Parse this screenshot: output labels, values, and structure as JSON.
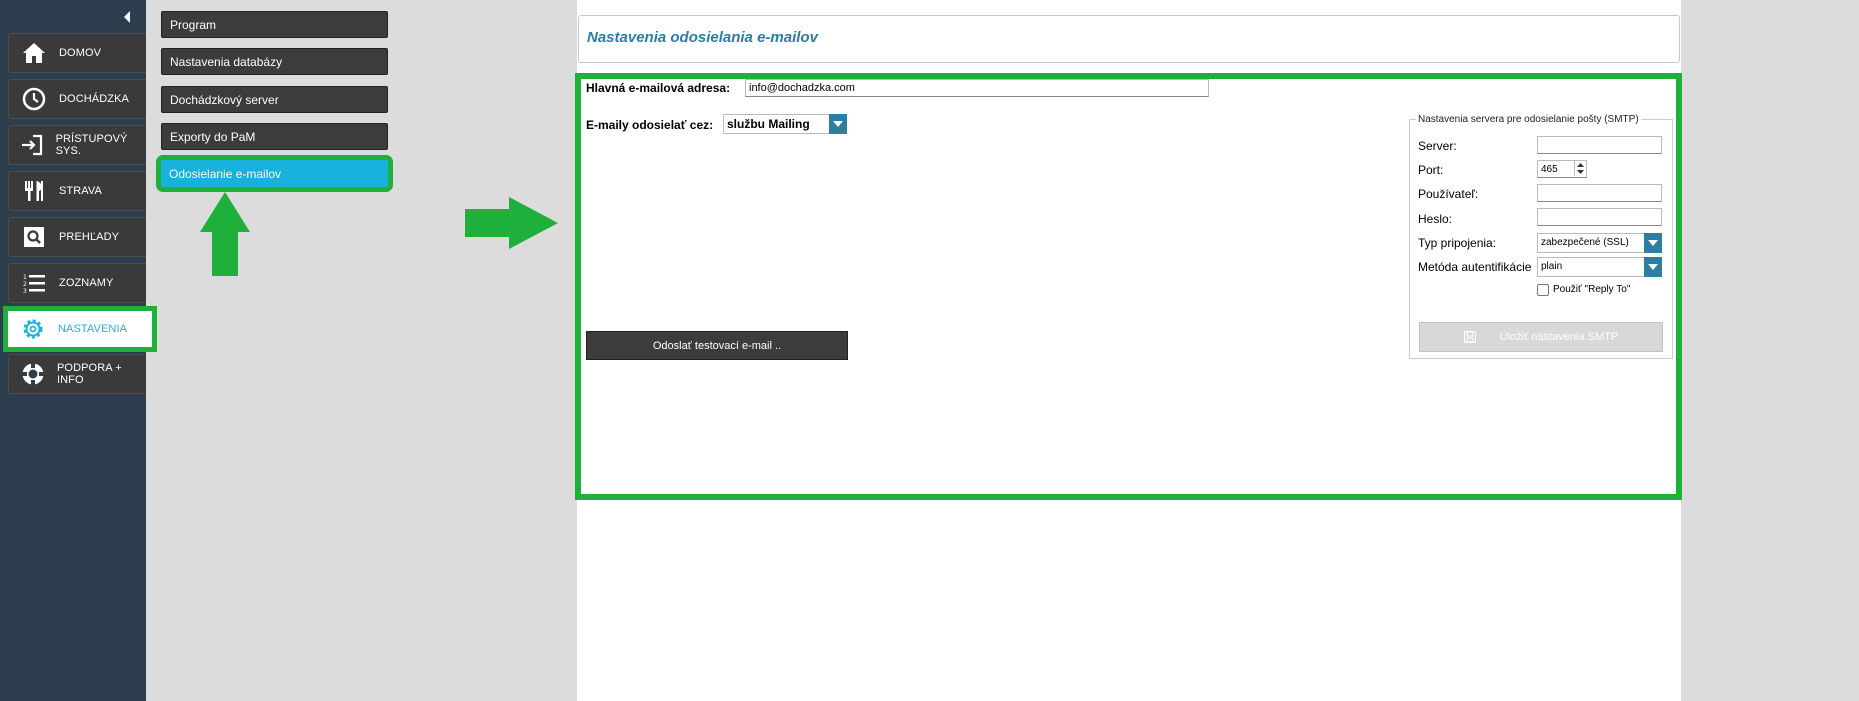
{
  "sidebar": {
    "items": [
      {
        "label": "DOMOV",
        "icon": "home-icon"
      },
      {
        "label": "DOCHÁDZKA",
        "icon": "clock-icon"
      },
      {
        "label": "PRÍSTUPOVÝ SYS.",
        "icon": "login-icon"
      },
      {
        "label": "STRAVA",
        "icon": "cutlery-icon"
      },
      {
        "label": "PREHĽADY",
        "icon": "search-icon"
      },
      {
        "label": "ZOZNAMY",
        "icon": "list-icon"
      },
      {
        "label": "NASTAVENIA",
        "icon": "gear-icon"
      },
      {
        "label": "PODPORA + INFO",
        "icon": "lifebuoy-icon"
      }
    ]
  },
  "submenu": {
    "items": [
      {
        "label": "Program"
      },
      {
        "label": "Nastavenia databázy"
      },
      {
        "label": "Dochádzkový server"
      },
      {
        "label": "Exporty do PaM"
      },
      {
        "label": "Odosielanie e-mailov"
      }
    ]
  },
  "main": {
    "title": "Nastavenia odosielania e-mailov",
    "email_label": "Hlavná e-mailová adresa:",
    "email_value": "info@dochadzka.com",
    "send_via_label": "E-maily odosielať cez:",
    "send_via_value": "službu Mailing",
    "test_button": "Odoslať testovací e-mail ..",
    "smtp": {
      "legend": "Nastavenia servera pre odosielanie pošty (SMTP)",
      "server_label": "Server:",
      "server_value": "",
      "port_label": "Port:",
      "port_value": "465",
      "user_label": "Používateľ:",
      "user_value": "",
      "password_label": "Heslo:",
      "password_value": "",
      "conn_type_label": "Typ pripojenia:",
      "conn_type_value": "zabezpečené (SSL)",
      "auth_label": "Metóda autentifikácie",
      "auth_value": "plain",
      "reply_to_label": "Použiť \"Reply To\"",
      "save_button": "Uložiť nastavenia SMTP"
    }
  },
  "colors": {
    "sidebar_bg": "#2d3e4f",
    "highlight_green": "#1fb03c",
    "accent_blue": "#17b1dc",
    "title_blue": "#2a7ea5"
  }
}
